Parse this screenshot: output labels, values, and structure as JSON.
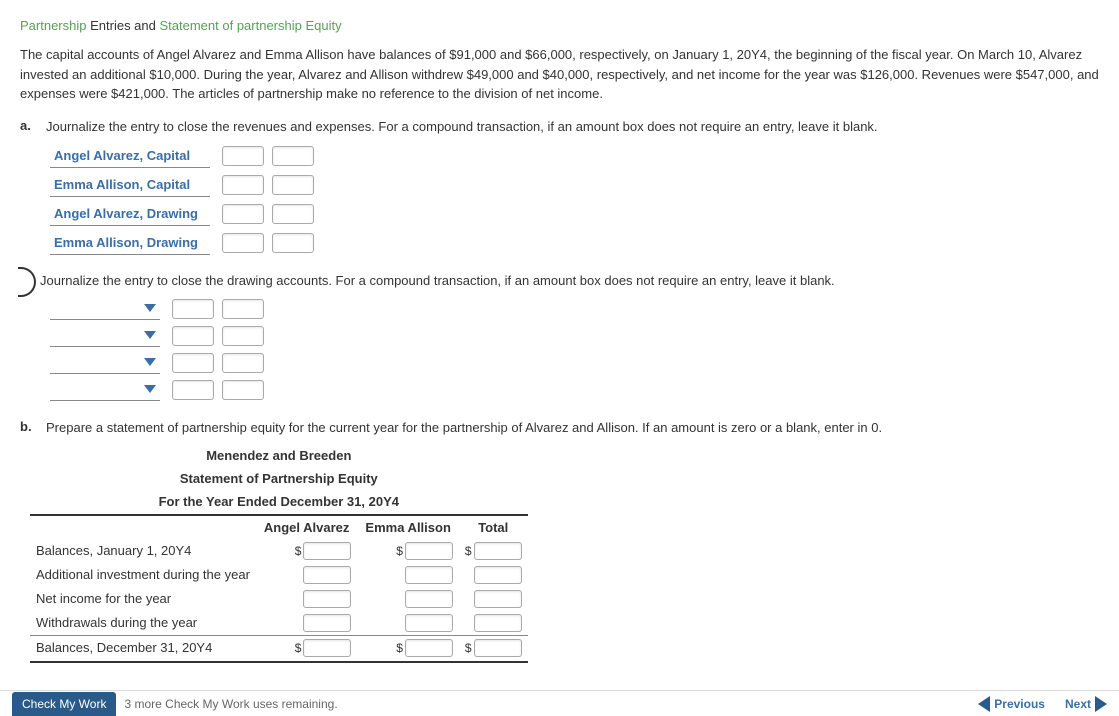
{
  "title": {
    "part1": "Partnership",
    "part2": "Entries and",
    "part3": "Statement of partnership Equity"
  },
  "intro": "The capital accounts of Angel Alvarez and Emma Allison have balances of $91,000 and $66,000, respectively, on January 1, 20Y4, the beginning of the fiscal year. On March 10, Alvarez invested an additional $10,000. During the year, Alvarez and Allison withdrew $49,000 and $40,000, respectively, and net income for the year was $126,000. Revenues were $547,000, and expenses were $421,000. The articles of partnership make no reference to the division of net income.",
  "parts": {
    "a": {
      "label": "a.",
      "text": "Journalize the entry to close the revenues and expenses. For a compound transaction, if an amount box does not require an entry, leave it blank.",
      "accounts": [
        "Angel Alvarez, Capital",
        "Emma Allison, Capital",
        "Angel Alvarez, Drawing",
        "Emma Allison, Drawing"
      ],
      "sub_text": "Journalize the entry to close the drawing accounts. For a compound transaction, if an amount box does not require an entry, leave it blank.",
      "dropdown_rows": 4
    },
    "b": {
      "label": "b.",
      "text": "Prepare a statement of partnership equity for the current year for the partnership of Alvarez and Allison. If an amount is zero or a blank, enter in 0."
    }
  },
  "statement": {
    "h1": "Menendez and Breeden",
    "h2": "Statement of Partnership Equity",
    "h3": "For the Year Ended December 31, 20Y4",
    "cols": [
      "Angel Alvarez",
      "Emma Allison",
      "Total"
    ],
    "rows": [
      "Balances, January 1, 20Y4",
      "Additional investment during the year",
      "Net income for the year",
      "Withdrawals during the year",
      "Balances, December 31, 20Y4"
    ]
  },
  "footer": {
    "check": "Check My Work",
    "remaining": "3 more Check My Work uses remaining.",
    "prev": "Previous",
    "next": "Next"
  }
}
